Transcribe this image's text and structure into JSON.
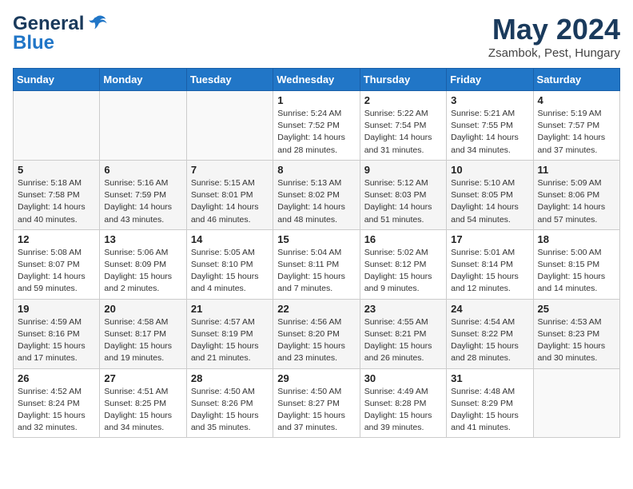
{
  "logo": {
    "general": "General",
    "blue": "Blue",
    "tagline": ""
  },
  "header": {
    "month_year": "May 2024",
    "location": "Zsambok, Pest, Hungary"
  },
  "weekdays": [
    "Sunday",
    "Monday",
    "Tuesday",
    "Wednesday",
    "Thursday",
    "Friday",
    "Saturday"
  ],
  "weeks": [
    [
      {
        "day": "",
        "info": ""
      },
      {
        "day": "",
        "info": ""
      },
      {
        "day": "",
        "info": ""
      },
      {
        "day": "1",
        "info": "Sunrise: 5:24 AM\nSunset: 7:52 PM\nDaylight: 14 hours and 28 minutes."
      },
      {
        "day": "2",
        "info": "Sunrise: 5:22 AM\nSunset: 7:54 PM\nDaylight: 14 hours and 31 minutes."
      },
      {
        "day": "3",
        "info": "Sunrise: 5:21 AM\nSunset: 7:55 PM\nDaylight: 14 hours and 34 minutes."
      },
      {
        "day": "4",
        "info": "Sunrise: 5:19 AM\nSunset: 7:57 PM\nDaylight: 14 hours and 37 minutes."
      }
    ],
    [
      {
        "day": "5",
        "info": "Sunrise: 5:18 AM\nSunset: 7:58 PM\nDaylight: 14 hours and 40 minutes."
      },
      {
        "day": "6",
        "info": "Sunrise: 5:16 AM\nSunset: 7:59 PM\nDaylight: 14 hours and 43 minutes."
      },
      {
        "day": "7",
        "info": "Sunrise: 5:15 AM\nSunset: 8:01 PM\nDaylight: 14 hours and 46 minutes."
      },
      {
        "day": "8",
        "info": "Sunrise: 5:13 AM\nSunset: 8:02 PM\nDaylight: 14 hours and 48 minutes."
      },
      {
        "day": "9",
        "info": "Sunrise: 5:12 AM\nSunset: 8:03 PM\nDaylight: 14 hours and 51 minutes."
      },
      {
        "day": "10",
        "info": "Sunrise: 5:10 AM\nSunset: 8:05 PM\nDaylight: 14 hours and 54 minutes."
      },
      {
        "day": "11",
        "info": "Sunrise: 5:09 AM\nSunset: 8:06 PM\nDaylight: 14 hours and 57 minutes."
      }
    ],
    [
      {
        "day": "12",
        "info": "Sunrise: 5:08 AM\nSunset: 8:07 PM\nDaylight: 14 hours and 59 minutes."
      },
      {
        "day": "13",
        "info": "Sunrise: 5:06 AM\nSunset: 8:09 PM\nDaylight: 15 hours and 2 minutes."
      },
      {
        "day": "14",
        "info": "Sunrise: 5:05 AM\nSunset: 8:10 PM\nDaylight: 15 hours and 4 minutes."
      },
      {
        "day": "15",
        "info": "Sunrise: 5:04 AM\nSunset: 8:11 PM\nDaylight: 15 hours and 7 minutes."
      },
      {
        "day": "16",
        "info": "Sunrise: 5:02 AM\nSunset: 8:12 PM\nDaylight: 15 hours and 9 minutes."
      },
      {
        "day": "17",
        "info": "Sunrise: 5:01 AM\nSunset: 8:14 PM\nDaylight: 15 hours and 12 minutes."
      },
      {
        "day": "18",
        "info": "Sunrise: 5:00 AM\nSunset: 8:15 PM\nDaylight: 15 hours and 14 minutes."
      }
    ],
    [
      {
        "day": "19",
        "info": "Sunrise: 4:59 AM\nSunset: 8:16 PM\nDaylight: 15 hours and 17 minutes."
      },
      {
        "day": "20",
        "info": "Sunrise: 4:58 AM\nSunset: 8:17 PM\nDaylight: 15 hours and 19 minutes."
      },
      {
        "day": "21",
        "info": "Sunrise: 4:57 AM\nSunset: 8:19 PM\nDaylight: 15 hours and 21 minutes."
      },
      {
        "day": "22",
        "info": "Sunrise: 4:56 AM\nSunset: 8:20 PM\nDaylight: 15 hours and 23 minutes."
      },
      {
        "day": "23",
        "info": "Sunrise: 4:55 AM\nSunset: 8:21 PM\nDaylight: 15 hours and 26 minutes."
      },
      {
        "day": "24",
        "info": "Sunrise: 4:54 AM\nSunset: 8:22 PM\nDaylight: 15 hours and 28 minutes."
      },
      {
        "day": "25",
        "info": "Sunrise: 4:53 AM\nSunset: 8:23 PM\nDaylight: 15 hours and 30 minutes."
      }
    ],
    [
      {
        "day": "26",
        "info": "Sunrise: 4:52 AM\nSunset: 8:24 PM\nDaylight: 15 hours and 32 minutes."
      },
      {
        "day": "27",
        "info": "Sunrise: 4:51 AM\nSunset: 8:25 PM\nDaylight: 15 hours and 34 minutes."
      },
      {
        "day": "28",
        "info": "Sunrise: 4:50 AM\nSunset: 8:26 PM\nDaylight: 15 hours and 35 minutes."
      },
      {
        "day": "29",
        "info": "Sunrise: 4:50 AM\nSunset: 8:27 PM\nDaylight: 15 hours and 37 minutes."
      },
      {
        "day": "30",
        "info": "Sunrise: 4:49 AM\nSunset: 8:28 PM\nDaylight: 15 hours and 39 minutes."
      },
      {
        "day": "31",
        "info": "Sunrise: 4:48 AM\nSunset: 8:29 PM\nDaylight: 15 hours and 41 minutes."
      },
      {
        "day": "",
        "info": ""
      }
    ]
  ]
}
